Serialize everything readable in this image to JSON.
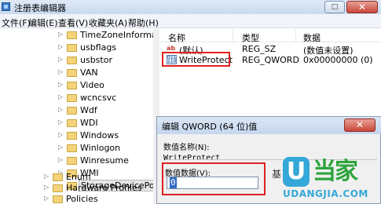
{
  "window": {
    "title": "注册表编辑器",
    "close_glyph": "✕",
    "maximize_glyph": "□"
  },
  "menu": [
    "文件(F)",
    "编辑(E)",
    "查看(V)",
    "收藏夹(A)",
    "帮助(H)"
  ],
  "tree": {
    "items": [
      {
        "label": "TimeZoneInformatio",
        "expandable": true
      },
      {
        "label": "usbflags",
        "expandable": true
      },
      {
        "label": "usbstor",
        "expandable": true
      },
      {
        "label": "VAN",
        "expandable": true
      },
      {
        "label": "Video",
        "expandable": true
      },
      {
        "label": "wcncsvc",
        "expandable": true
      },
      {
        "label": "Wdf",
        "expandable": true
      },
      {
        "label": "WDI",
        "expandable": true
      },
      {
        "label": "Windows",
        "expandable": true
      },
      {
        "label": "Winlogon",
        "expandable": true
      },
      {
        "label": "Winresume",
        "expandable": true
      },
      {
        "label": "WMI",
        "expandable": true
      },
      {
        "label": "StorageDevicePolicie",
        "expandable": false,
        "selected": true
      }
    ],
    "sibling_items": [
      {
        "label": "Enum",
        "expandable": true
      },
      {
        "label": "Hardware Profiles",
        "expandable": true
      },
      {
        "label": "Policies",
        "expandable": true
      }
    ]
  },
  "list": {
    "columns": [
      "名称",
      "类型",
      "数据"
    ],
    "rows": [
      {
        "name": "(默认)",
        "type": "REG_SZ",
        "data": "(数值未设置)",
        "icon": "string-value-icon"
      },
      {
        "name": "WriteProtect",
        "type": "REG_QWORD",
        "data": "0x00000000 (0)",
        "icon": "binary-value-icon"
      }
    ]
  },
  "dialog": {
    "title": "编辑 QWORD (64 位)值",
    "close_glyph": "✕",
    "name_label": "数值名称(N):",
    "name_value": "WriteProtect",
    "data_label": "数值数据(V):",
    "data_value": "0",
    "radix_label": "基"
  },
  "watermark": {
    "logo_letter": "U",
    "logo_text": "当家",
    "domain": "UDANGJIA.COM"
  },
  "colors": {
    "highlight": "#e02020",
    "logo_blue": "#34a8d8",
    "logo_green": "#2ea43d"
  }
}
